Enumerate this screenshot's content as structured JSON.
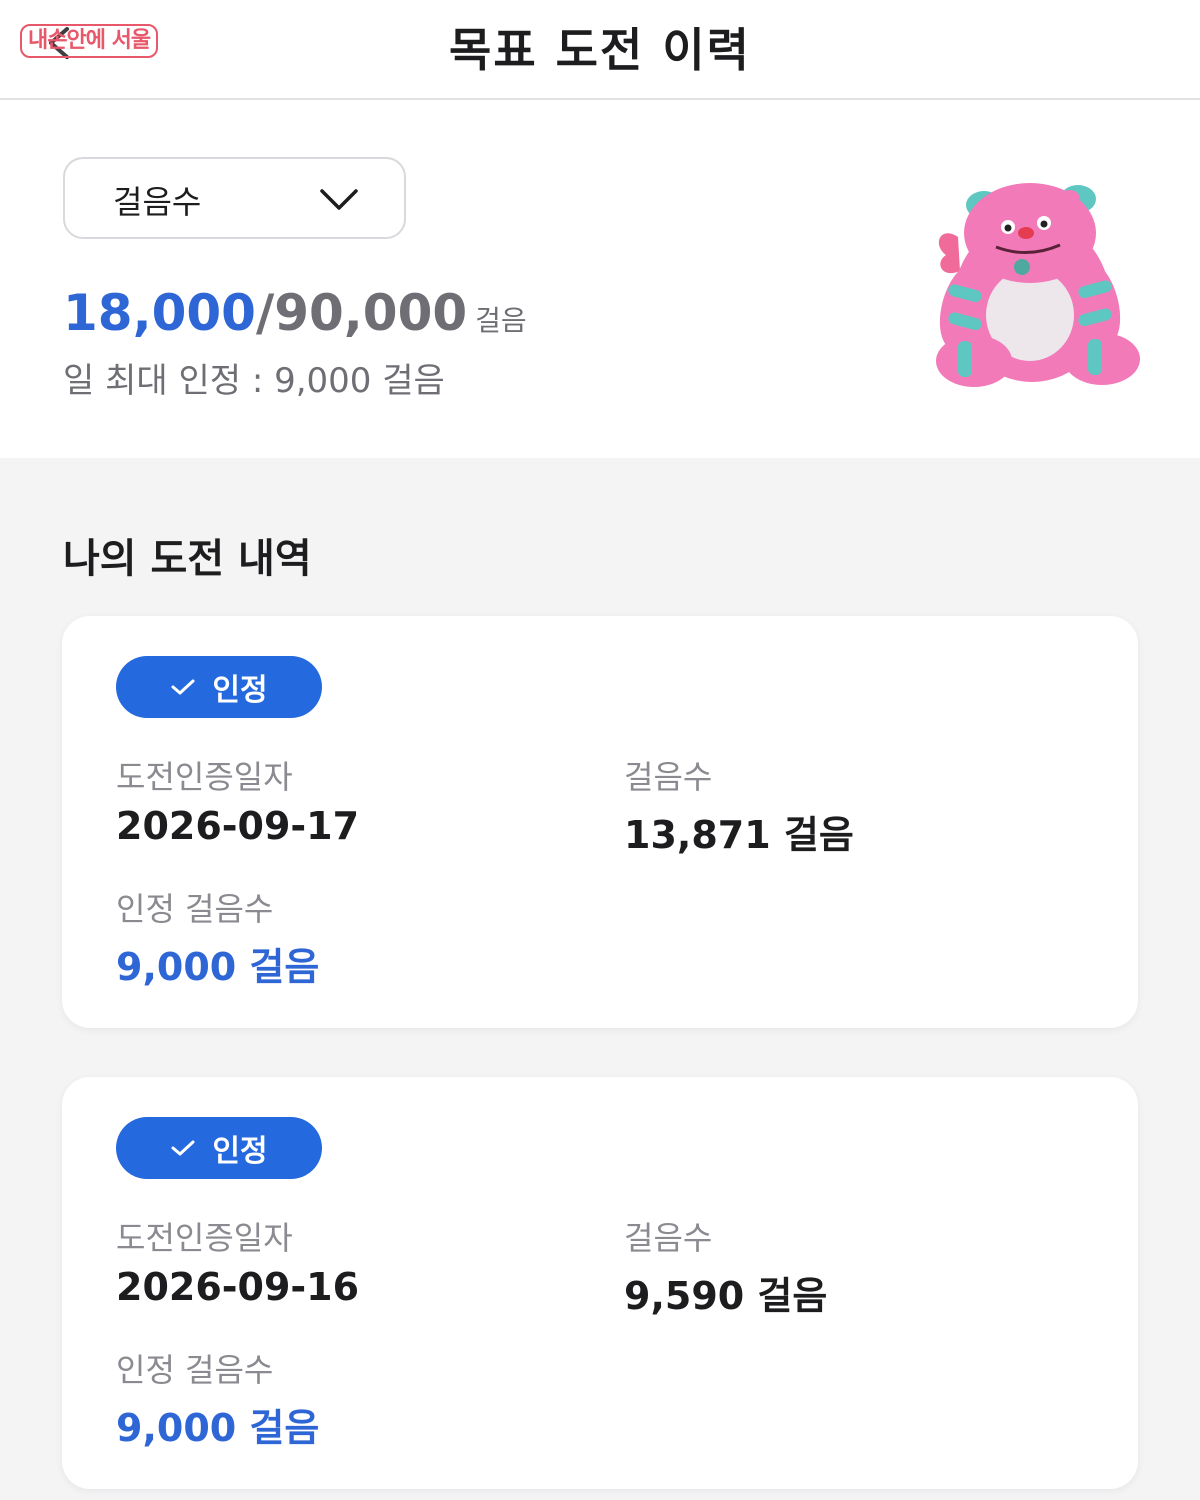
{
  "header": {
    "title": "목표 도전 이력",
    "watermark": "내손안에 서울"
  },
  "summary": {
    "metric_select": {
      "selected": "걸음수"
    },
    "progress": {
      "current": "18,000",
      "separator": "/",
      "goal": "90,000",
      "unit": "걸음"
    },
    "daily_max": "일 최대 인정 : 9,000 걸음"
  },
  "history": {
    "title": "나의 도전 내역",
    "cards": [
      {
        "badge": "인정",
        "date_label": "도전인증일자",
        "date": "2026-09-17",
        "steps_label": "걸음수",
        "steps": "13,871 걸음",
        "recognized_label": "인정 걸음수",
        "recognized": "9,000 걸음"
      },
      {
        "badge": "인정",
        "date_label": "도전인증일자",
        "date": "2026-09-16",
        "steps_label": "걸음수",
        "steps": "9,590 걸음",
        "recognized_label": "인정 걸음수",
        "recognized": "9,000 걸음"
      }
    ]
  },
  "colors": {
    "accent_blue": "#2f66d6",
    "badge_blue": "#2469de",
    "watermark_red": "#e8576a",
    "text_gray": "#6e6e74"
  },
  "icons": {
    "back": "back-arrow-icon",
    "dropdown": "chevron-down-icon",
    "badge": "check-icon",
    "mascot": "pink-monster-mascot"
  }
}
